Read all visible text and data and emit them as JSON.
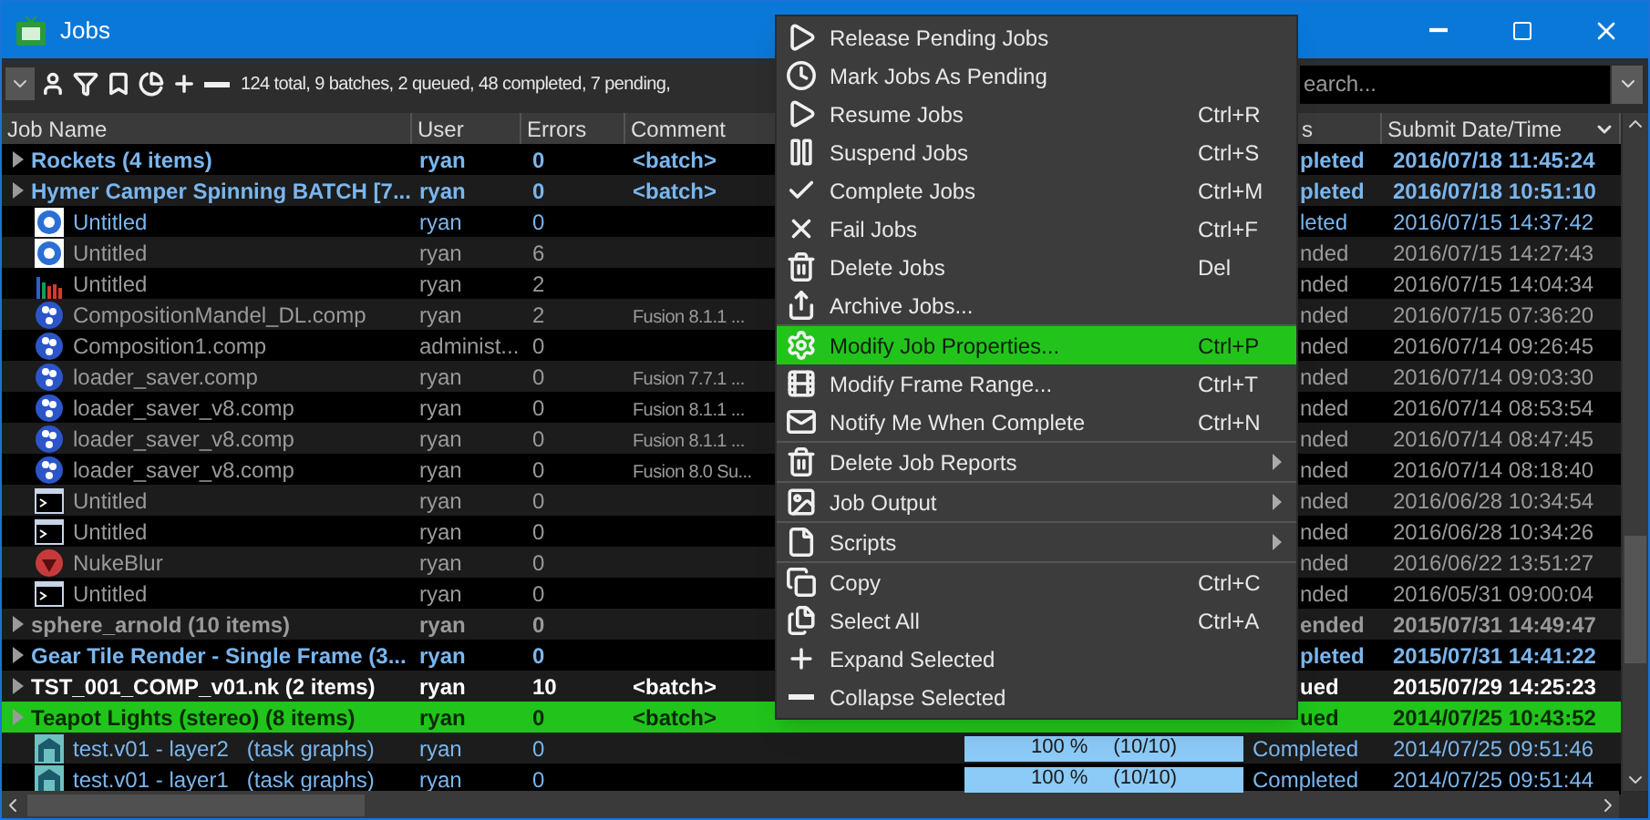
{
  "window": {
    "title": "Jobs"
  },
  "toolbar": {
    "summary": "124 total, 9 batches, 2 queued, 48 completed, 7 pending,",
    "search": {
      "placeholder": "earch..."
    }
  },
  "table": {
    "columns": [
      {
        "label": "Job Name"
      },
      {
        "label": "User"
      },
      {
        "label": "Errors"
      },
      {
        "label": "Comment"
      },
      {
        "label": "s"
      },
      {
        "label": "Submit Date/Time",
        "sorted": true
      }
    ],
    "rows": [
      {
        "kind": "batch",
        "name": "Rockets (4 items)",
        "user": "ryan",
        "errors": "0",
        "comment": "<batch>",
        "color": "#7ab6ee",
        "status": "pleted",
        "submitted": "2016/07/18 11:45:24",
        "selected": false
      },
      {
        "kind": "batch",
        "name": "Hymer Camper Spinning BATCH [7...",
        "user": "ryan",
        "errors": "0",
        "comment": "<batch>",
        "color": "#7ab6ee",
        "status": "pleted",
        "submitted": "2016/07/18 10:51:10",
        "selected": false
      },
      {
        "kind": "render",
        "name": "Untitled",
        "user": "ryan",
        "errors": "0",
        "color": "#7ab6ee",
        "status": "leted",
        "submitted": "2016/07/15 14:37:42",
        "selected": false
      },
      {
        "kind": "render",
        "name": "Untitled",
        "user": "ryan",
        "errors": "6",
        "color": "#9a9a9a",
        "status": "nded",
        "submitted": "2016/07/15 14:27:43",
        "selected": false
      },
      {
        "kind": "chart",
        "name": "Untitled",
        "user": "ryan",
        "errors": "2",
        "color": "#9a9a9a",
        "status": "nded",
        "submitted": "2016/07/15 14:04:34",
        "selected": false
      },
      {
        "kind": "comp",
        "name": "CompositionMandel_DL.comp",
        "user": "ryan",
        "errors": "2",
        "comment": "Fusion 8.1.1 ...",
        "color": "#9a9a9a",
        "status": "nded",
        "submitted": "2016/07/15 07:36:20",
        "selected": false
      },
      {
        "kind": "comp",
        "name": "Composition1.comp",
        "user": "administ...",
        "errors": "0",
        "color": "#9a9a9a",
        "status": "nded",
        "submitted": "2016/07/14 09:26:45",
        "selected": false
      },
      {
        "kind": "comp",
        "name": "loader_saver.comp",
        "user": "ryan",
        "errors": "0",
        "comment": "Fusion 7.7.1 ...",
        "color": "#9a9a9a",
        "status": "nded",
        "submitted": "2016/07/14 09:03:30",
        "selected": false
      },
      {
        "kind": "comp",
        "name": "loader_saver_v8.comp",
        "user": "ryan",
        "errors": "0",
        "comment": "Fusion 8.1.1 ...",
        "color": "#9a9a9a",
        "status": "nded",
        "submitted": "2016/07/14 08:53:54",
        "selected": false
      },
      {
        "kind": "comp",
        "name": "loader_saver_v8.comp",
        "user": "ryan",
        "errors": "0",
        "comment": "Fusion 8.1.1 ...",
        "color": "#9a9a9a",
        "status": "nded",
        "submitted": "2016/07/14 08:47:45",
        "selected": false
      },
      {
        "kind": "comp",
        "name": "loader_saver_v8.comp",
        "user": "ryan",
        "errors": "0",
        "comment": "Fusion 8.0 Su...",
        "color": "#9a9a9a",
        "status": "nded",
        "submitted": "2016/07/14 08:18:40",
        "selected": false
      },
      {
        "kind": "console",
        "name": "Untitled",
        "user": "ryan",
        "errors": "0",
        "color": "#9a9a9a",
        "status": "nded",
        "submitted": "2016/06/28 10:34:54",
        "selected": false
      },
      {
        "kind": "console",
        "name": "Untitled",
        "user": "ryan",
        "errors": "0",
        "color": "#9a9a9a",
        "status": "nded",
        "submitted": "2016/06/28 10:34:26",
        "selected": false
      },
      {
        "kind": "nuke",
        "name": "NukeBlur",
        "user": "ryan",
        "errors": "0",
        "color": "#9a9a9a",
        "status": "nded",
        "submitted": "2016/06/22 13:51:27",
        "selected": false
      },
      {
        "kind": "console",
        "name": "Untitled",
        "user": "ryan",
        "errors": "0",
        "color": "#9a9a9a",
        "status": "nded",
        "submitted": "2016/05/31 09:00:04",
        "selected": false
      },
      {
        "kind": "batch",
        "name": "sphere_arnold (10 items)",
        "user": "ryan",
        "errors": "0",
        "color": "#9a9a9a",
        "status": "ended",
        "submitted": "2015/07/31 14:49:47",
        "selected": false
      },
      {
        "kind": "batch",
        "name": "Gear Tile Render - Single Frame (3...",
        "user": "ryan",
        "errors": "0",
        "color": "#7ab6ee",
        "status": "pleted",
        "submitted": "2015/07/31 14:41:22",
        "selected": false
      },
      {
        "kind": "batch",
        "name": "TST_001_COMP_v01.nk (2 items)",
        "user": "ryan",
        "errors": "10",
        "comment": "<batch>",
        "color": "#ffffff",
        "status": "ued",
        "submitted": "2015/07/29 14:25:23",
        "selected": false
      },
      {
        "kind": "batch",
        "name": "Teapot Lights (stereo) (8 items)",
        "user": "ryan",
        "errors": "0",
        "comment": "<batch>",
        "status": "ued",
        "submitted": "2014/07/25 10:43:52",
        "selected": true
      },
      {
        "kind": "graph",
        "name": "test.v01 - layer2   (task graphs)",
        "user": "ryan",
        "errors": "0",
        "progress": {
          "level": 1,
          "percent": "100 %",
          "count": "(10/10)"
        },
        "color": "#7ab6ee",
        "status": "Completed",
        "submitted": "2014/07/25 09:51:46",
        "selected": false
      },
      {
        "kind": "graph",
        "name": "test.v01 - layer1   (task graphs)",
        "user": "ryan",
        "errors": "0",
        "progress": {
          "level": 1,
          "percent": "100 %",
          "count": "(10/10)"
        },
        "color": "#7ab6ee",
        "status": "Completed",
        "submitted": "2014/07/25 09:51:44",
        "selected": false
      }
    ]
  },
  "context_menu": {
    "groups": [
      [
        {
          "label": "Release Pending Jobs",
          "selected": false
        },
        {
          "label": "Mark Jobs As Pending",
          "selected": false
        },
        {
          "label": "Resume Jobs",
          "shortcut": "Ctrl+R",
          "selected": false
        },
        {
          "label": "Suspend Jobs",
          "shortcut": "Ctrl+S",
          "selected": false
        },
        {
          "label": "Complete Jobs",
          "shortcut": "Ctrl+M",
          "selected": false
        },
        {
          "label": "Fail Jobs",
          "shortcut": "Ctrl+F",
          "selected": false
        },
        {
          "label": "Delete Jobs",
          "shortcut": "Del",
          "selected": false
        },
        {
          "label": "Archive Jobs...",
          "selected": false
        }
      ],
      [
        {
          "label": "Modify Job Properties...",
          "shortcut": "Ctrl+P",
          "selected": true
        },
        {
          "label": "Modify Frame Range...",
          "shortcut": "Ctrl+T",
          "selected": false
        },
        {
          "label": "Notify Me When Complete",
          "shortcut": "Ctrl+N",
          "selected": false
        }
      ],
      [
        {
          "label": "Delete Job Reports",
          "submenu": true,
          "selected": false
        }
      ],
      [
        {
          "label": "Job Output",
          "submenu": true,
          "selected": false
        }
      ],
      [
        {
          "label": "Scripts",
          "submenu": true,
          "selected": false
        }
      ],
      [
        {
          "label": "Copy",
          "shortcut": "Ctrl+C",
          "selected": false
        },
        {
          "label": "Select All",
          "shortcut": "Ctrl+A",
          "selected": false
        },
        {
          "label": "Expand Selected",
          "selected": false
        },
        {
          "label": "Collapse Selected",
          "selected": false
        }
      ]
    ]
  }
}
